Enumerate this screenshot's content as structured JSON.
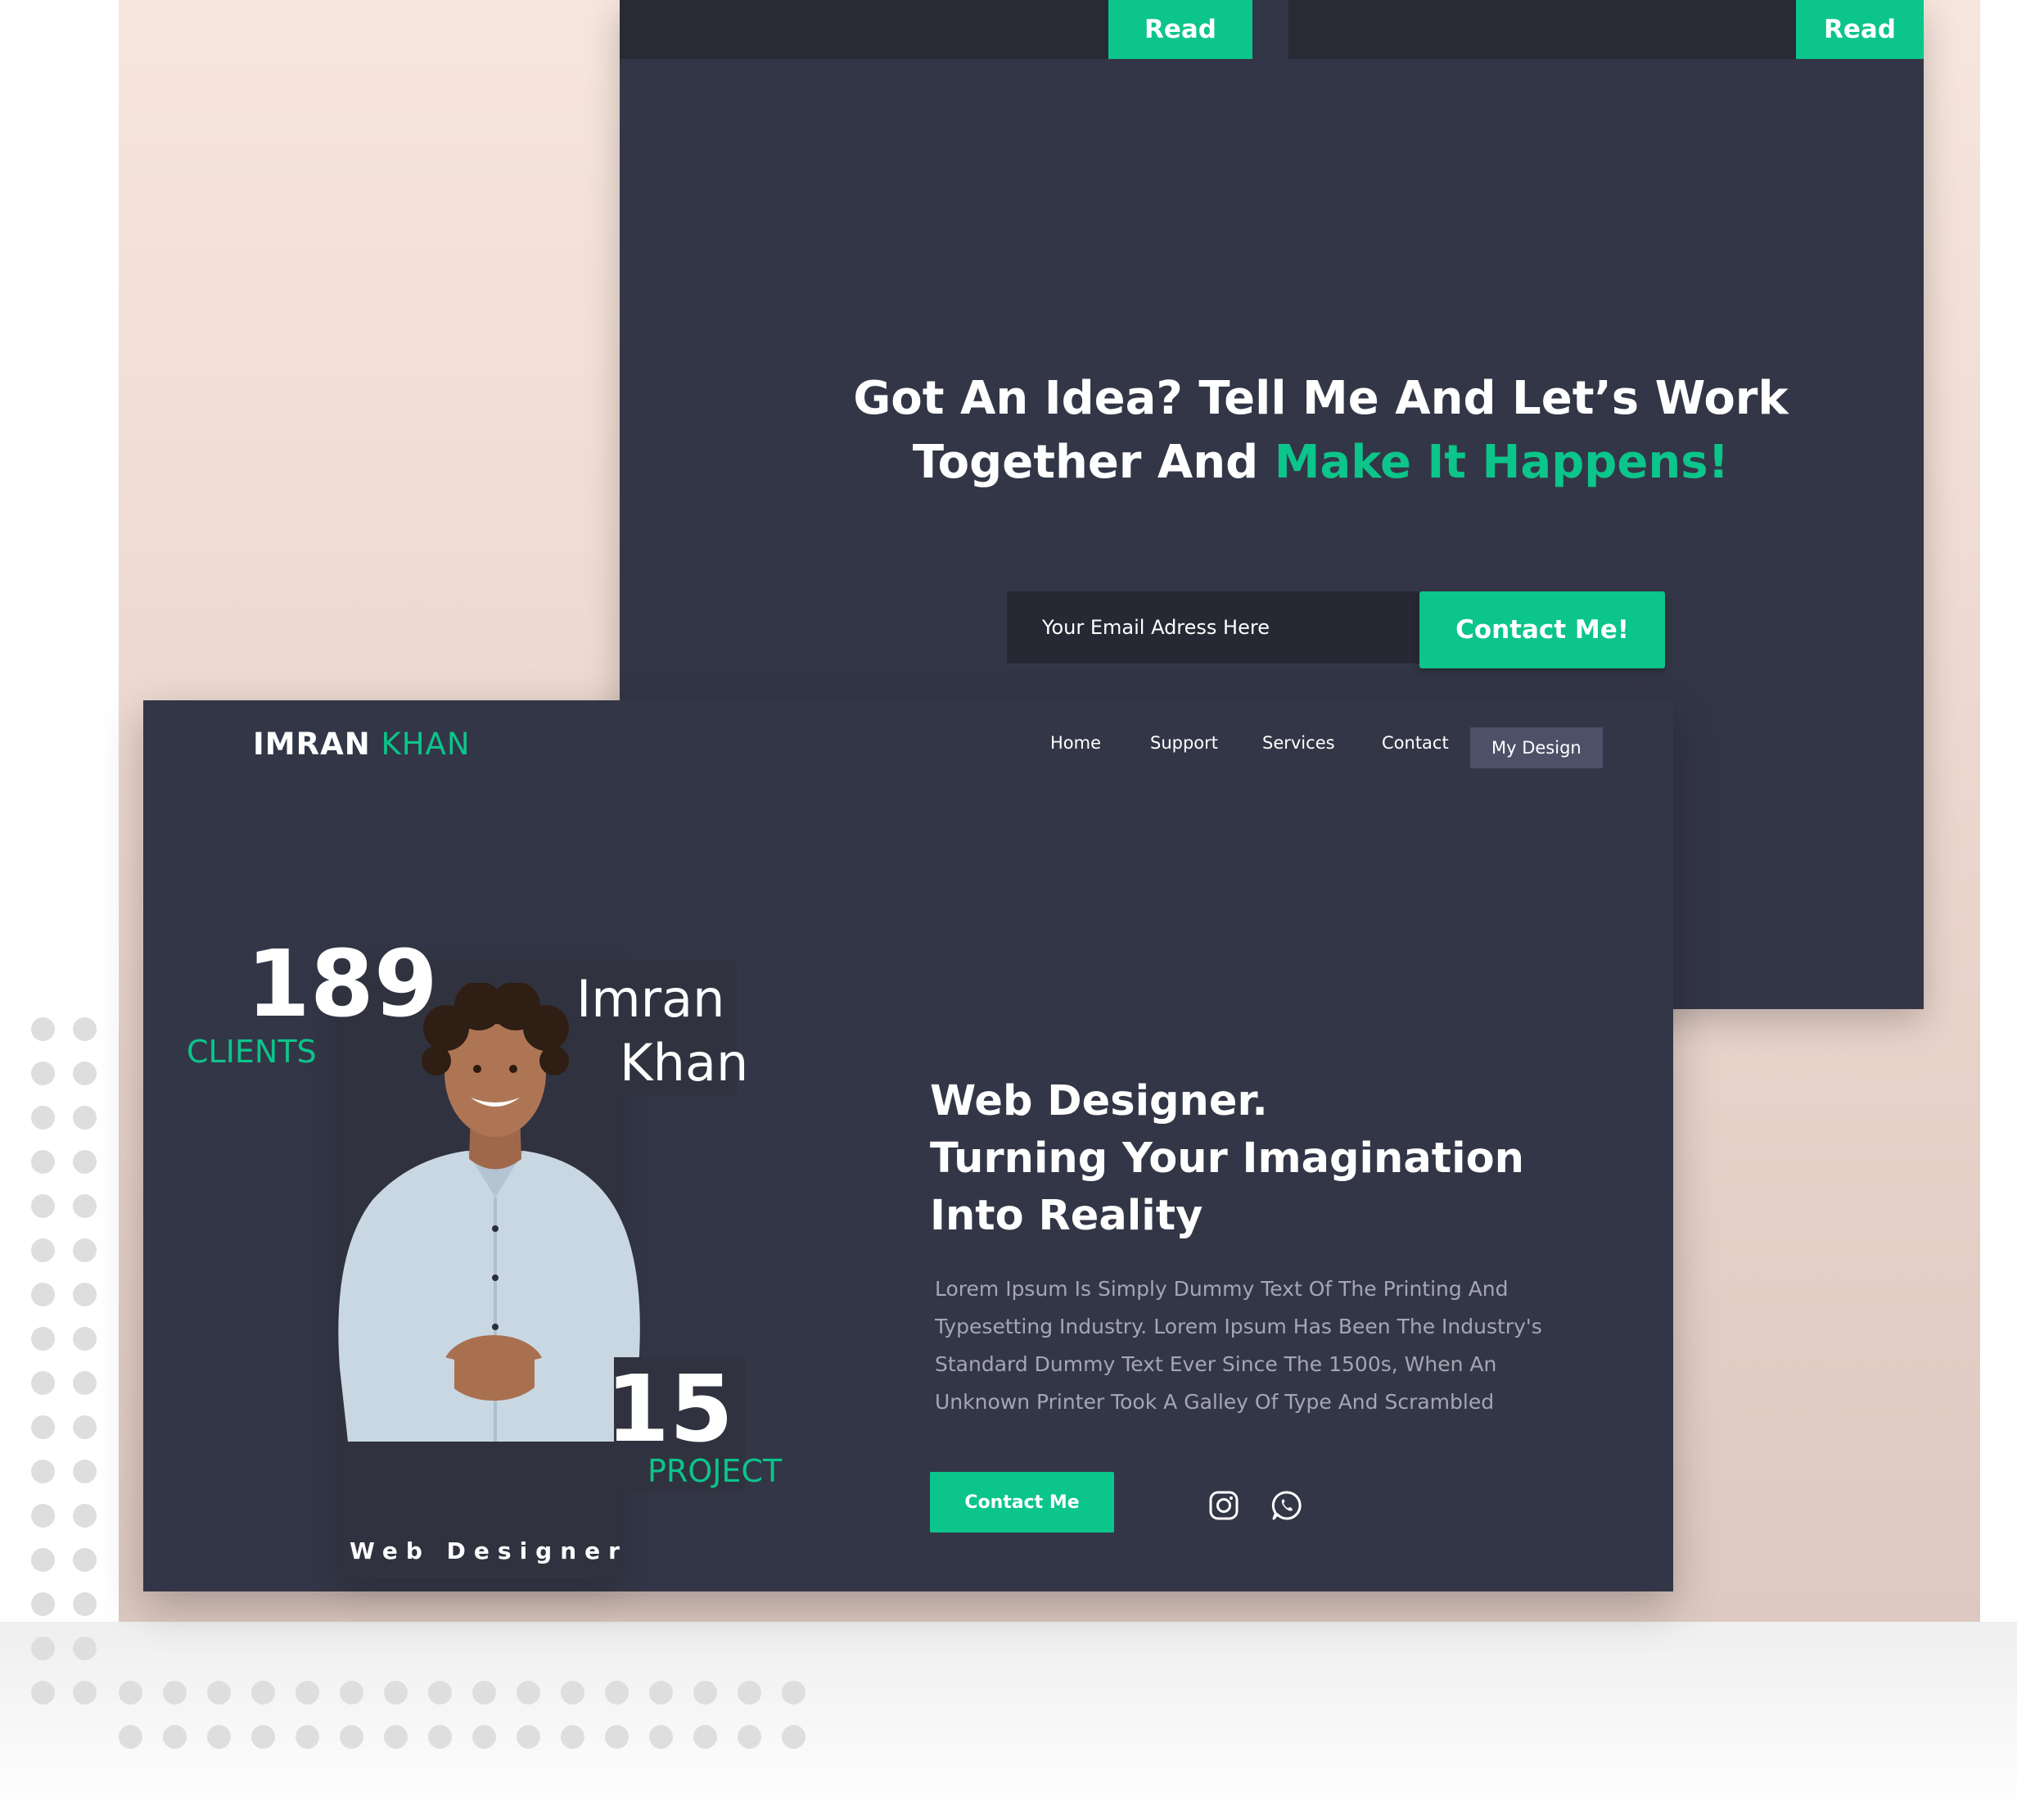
{
  "colors": {
    "accent": "#0bc58a",
    "panel": "#333646",
    "panel_dark": "#282a36",
    "backdrop": "#f7e6de",
    "nav_active": "#4d5168"
  },
  "blog_cards": [
    {
      "read_label": "Read"
    },
    {
      "read_label": "Read"
    }
  ],
  "cta": {
    "heading_line1": "Got An Idea? Tell Me And Let’s Work",
    "heading_line2_plain": "Together And ",
    "heading_line2_accent": "Make It Happens!",
    "email_placeholder": "Your Email Adress Here",
    "button_label": "Contact Me!"
  },
  "header": {
    "logo_first": "IMRAN",
    "logo_last": "KHAN",
    "nav": [
      {
        "label": "Home"
      },
      {
        "label": "Support"
      },
      {
        "label": "Services"
      },
      {
        "label": "Contact"
      },
      {
        "label": "My Design"
      }
    ]
  },
  "profile": {
    "clients_count": "189",
    "clients_label": "CLIENTS",
    "name_line1": "Imran",
    "name_line2": "Khan",
    "projects_count": "15",
    "projects_label": "PROJECT",
    "role": "Web Designer"
  },
  "hero": {
    "title_lines": [
      "Web Designer.",
      "Turning Your Imagination",
      "Into Reality"
    ],
    "body_lines": [
      "Lorem Ipsum Is Simply Dummy Text Of The Printing And",
      "Typesetting Industry. Lorem Ipsum Has Been The Industry's",
      "Standard Dummy Text Ever Since The 1500s, When An",
      "Unknown Printer Took A Galley Of Type And Scrambled"
    ],
    "button_label": "Contact Me",
    "social": [
      {
        "icon": "instagram-icon"
      },
      {
        "icon": "whatsapp-icon"
      }
    ]
  }
}
